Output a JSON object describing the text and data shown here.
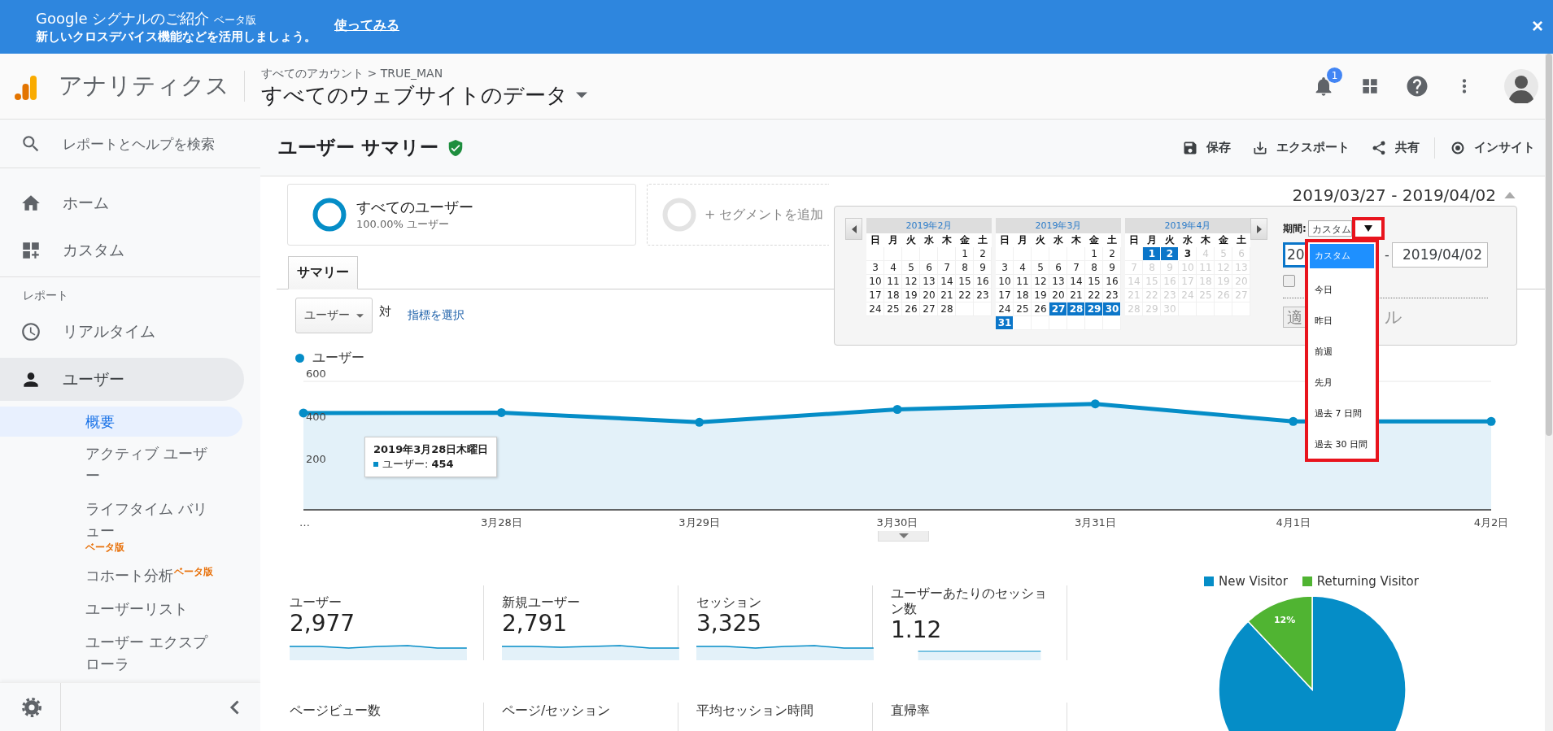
{
  "banner": {
    "title": "Google シグナルのご紹介",
    "badge": "ベータ版",
    "message": "新しいクロスデバイス機能などを活用しましょう。",
    "link": "使ってみる",
    "close": "×"
  },
  "header": {
    "product": "アナリティクス",
    "breadcrumb": "すべてのアカウント > TRUE_MAN",
    "view": "すべてのウェブサイトのデータ",
    "notifications": "1"
  },
  "sidebar": {
    "search": {
      "placeholder": "レポートとヘルプを検索"
    },
    "items": [
      {
        "kind": "home",
        "label": "ホーム",
        "selected": false
      },
      {
        "kind": "dashboards",
        "label": "カスタム",
        "selected": false
      },
      {
        "kind": "section",
        "label": "レポート"
      },
      {
        "kind": "clock",
        "label": "リアルタイム",
        "selected": false
      },
      {
        "kind": "person",
        "label": "ユーザー",
        "selected": true,
        "children": [
          {
            "kind": "plain",
            "label": "概要",
            "selected": true
          },
          {
            "kind": "plain",
            "label": "アクティブ ユーザー",
            "selected": false
          },
          {
            "kind": "badge_below",
            "label": "ライフタイム バリュー",
            "selected": false,
            "badge": "ベータ版"
          },
          {
            "kind": "badge_super",
            "label": "コホート分析",
            "selected": false,
            "badge": "ベータ版"
          },
          {
            "kind": "plain",
            "label": "ユーザーリスト",
            "selected": false
          },
          {
            "kind": "plain",
            "label": "ユーザー エクスプローラ",
            "selected": false
          }
        ]
      }
    ]
  },
  "page": {
    "title": "ユーザー サマリー",
    "actions": [
      {
        "kind": "save",
        "label": "保存"
      },
      {
        "kind": "export",
        "label": "エクスポート"
      },
      {
        "kind": "share",
        "label": "共有"
      },
      {
        "kind": "insights",
        "label": "インサイト"
      }
    ]
  },
  "segments": [
    {
      "kind": "segment",
      "name": "すべてのユーザー",
      "detail": "100.00% ユーザー"
    },
    {
      "kind": "add",
      "name": "+ セグメントを追加"
    }
  ],
  "date_range": {
    "label": "2019/03/27 - 2019/04/02",
    "expanded": true
  },
  "calendar": {
    "months": [
      {
        "title": "2019年2月",
        "weekdays": [
          "日",
          "月",
          "火",
          "水",
          "木",
          "金",
          "土"
        ],
        "days": [
          {
            "kind": "blank"
          },
          {
            "kind": "blank"
          },
          {
            "kind": "blank"
          },
          {
            "kind": "blank"
          },
          {
            "kind": "blank"
          },
          {
            "kind": "day",
            "d": "1",
            "selected": false,
            "today": false,
            "disabled": false
          },
          {
            "kind": "day",
            "d": "2",
            "selected": false,
            "today": false,
            "disabled": false
          },
          {
            "kind": "day",
            "d": "3",
            "selected": false,
            "today": false,
            "disabled": false
          },
          {
            "kind": "day",
            "d": "4",
            "selected": false,
            "today": false,
            "disabled": false
          },
          {
            "kind": "day",
            "d": "5",
            "selected": false,
            "today": false,
            "disabled": false
          },
          {
            "kind": "day",
            "d": "6",
            "selected": false,
            "today": false,
            "disabled": false
          },
          {
            "kind": "day",
            "d": "7",
            "selected": false,
            "today": false,
            "disabled": false
          },
          {
            "kind": "day",
            "d": "8",
            "selected": false,
            "today": false,
            "disabled": false
          },
          {
            "kind": "day",
            "d": "9",
            "selected": false,
            "today": false,
            "disabled": false
          },
          {
            "kind": "day",
            "d": "10",
            "selected": false,
            "today": false,
            "disabled": false
          },
          {
            "kind": "day",
            "d": "11",
            "selected": false,
            "today": false,
            "disabled": false
          },
          {
            "kind": "day",
            "d": "12",
            "selected": false,
            "today": false,
            "disabled": false
          },
          {
            "kind": "day",
            "d": "13",
            "selected": false,
            "today": false,
            "disabled": false
          },
          {
            "kind": "day",
            "d": "14",
            "selected": false,
            "today": false,
            "disabled": false
          },
          {
            "kind": "day",
            "d": "15",
            "selected": false,
            "today": false,
            "disabled": false
          },
          {
            "kind": "day",
            "d": "16",
            "selected": false,
            "today": false,
            "disabled": false
          },
          {
            "kind": "day",
            "d": "17",
            "selected": false,
            "today": false,
            "disabled": false
          },
          {
            "kind": "day",
            "d": "18",
            "selected": false,
            "today": false,
            "disabled": false
          },
          {
            "kind": "day",
            "d": "19",
            "selected": false,
            "today": false,
            "disabled": false
          },
          {
            "kind": "day",
            "d": "20",
            "selected": false,
            "today": false,
            "disabled": false
          },
          {
            "kind": "day",
            "d": "21",
            "selected": false,
            "today": false,
            "disabled": false
          },
          {
            "kind": "day",
            "d": "22",
            "selected": false,
            "today": false,
            "disabled": false
          },
          {
            "kind": "day",
            "d": "23",
            "selected": false,
            "today": false,
            "disabled": false
          },
          {
            "kind": "day",
            "d": "24",
            "selected": false,
            "today": false,
            "disabled": false
          },
          {
            "kind": "day",
            "d": "25",
            "selected": false,
            "today": false,
            "disabled": false
          },
          {
            "kind": "day",
            "d": "26",
            "selected": false,
            "today": false,
            "disabled": false
          },
          {
            "kind": "day",
            "d": "27",
            "selected": false,
            "today": false,
            "disabled": false
          },
          {
            "kind": "day",
            "d": "28",
            "selected": false,
            "today": false,
            "disabled": false
          }
        ]
      },
      {
        "title": "2019年3月",
        "weekdays": [
          "日",
          "月",
          "火",
          "水",
          "木",
          "金",
          "土"
        ],
        "days": [
          {
            "kind": "blank"
          },
          {
            "kind": "blank"
          },
          {
            "kind": "blank"
          },
          {
            "kind": "blank"
          },
          {
            "kind": "blank"
          },
          {
            "kind": "day",
            "d": "1",
            "selected": false,
            "today": false,
            "disabled": false
          },
          {
            "kind": "day",
            "d": "2",
            "selected": false,
            "today": false,
            "disabled": false
          },
          {
            "kind": "day",
            "d": "3",
            "selected": false,
            "today": false,
            "disabled": false
          },
          {
            "kind": "day",
            "d": "4",
            "selected": false,
            "today": false,
            "disabled": false
          },
          {
            "kind": "day",
            "d": "5",
            "selected": false,
            "today": false,
            "disabled": false
          },
          {
            "kind": "day",
            "d": "6",
            "selected": false,
            "today": false,
            "disabled": false
          },
          {
            "kind": "day",
            "d": "7",
            "selected": false,
            "today": false,
            "disabled": false
          },
          {
            "kind": "day",
            "d": "8",
            "selected": false,
            "today": false,
            "disabled": false
          },
          {
            "kind": "day",
            "d": "9",
            "selected": false,
            "today": false,
            "disabled": false
          },
          {
            "kind": "day",
            "d": "10",
            "selected": false,
            "today": false,
            "disabled": false
          },
          {
            "kind": "day",
            "d": "11",
            "selected": false,
            "today": false,
            "disabled": false
          },
          {
            "kind": "day",
            "d": "12",
            "selected": false,
            "today": false,
            "disabled": false
          },
          {
            "kind": "day",
            "d": "13",
            "selected": false,
            "today": false,
            "disabled": false
          },
          {
            "kind": "day",
            "d": "14",
            "selected": false,
            "today": false,
            "disabled": false
          },
          {
            "kind": "day",
            "d": "15",
            "selected": false,
            "today": false,
            "disabled": false
          },
          {
            "kind": "day",
            "d": "16",
            "selected": false,
            "today": false,
            "disabled": false
          },
          {
            "kind": "day",
            "d": "17",
            "selected": false,
            "today": false,
            "disabled": false
          },
          {
            "kind": "day",
            "d": "18",
            "selected": false,
            "today": false,
            "disabled": false
          },
          {
            "kind": "day",
            "d": "19",
            "selected": false,
            "today": false,
            "disabled": false
          },
          {
            "kind": "day",
            "d": "20",
            "selected": false,
            "today": false,
            "disabled": false
          },
          {
            "kind": "day",
            "d": "21",
            "selected": false,
            "today": false,
            "disabled": false
          },
          {
            "kind": "day",
            "d": "22",
            "selected": false,
            "today": false,
            "disabled": false
          },
          {
            "kind": "day",
            "d": "23",
            "selected": false,
            "today": false,
            "disabled": false
          },
          {
            "kind": "day",
            "d": "24",
            "selected": false,
            "today": false,
            "disabled": false
          },
          {
            "kind": "day",
            "d": "25",
            "selected": false,
            "today": false,
            "disabled": false
          },
          {
            "kind": "day",
            "d": "26",
            "selected": false,
            "today": false,
            "disabled": false
          },
          {
            "kind": "day",
            "d": "27",
            "selected": true,
            "today": false,
            "disabled": false
          },
          {
            "kind": "day",
            "d": "28",
            "selected": true,
            "today": false,
            "disabled": false
          },
          {
            "kind": "day",
            "d": "29",
            "selected": true,
            "today": false,
            "disabled": false
          },
          {
            "kind": "day",
            "d": "30",
            "selected": true,
            "today": false,
            "disabled": false
          },
          {
            "kind": "day",
            "d": "31",
            "selected": true,
            "today": false,
            "disabled": false
          }
        ]
      },
      {
        "title": "2019年4月",
        "weekdays": [
          "日",
          "月",
          "火",
          "水",
          "木",
          "金",
          "土"
        ],
        "days": [
          {
            "kind": "blank"
          },
          {
            "kind": "day",
            "d": "1",
            "selected": true,
            "today": false,
            "disabled": false
          },
          {
            "kind": "day",
            "d": "2",
            "selected": true,
            "today": false,
            "disabled": false
          },
          {
            "kind": "day",
            "d": "3",
            "selected": false,
            "today": true,
            "disabled": false
          },
          {
            "kind": "day",
            "d": "4",
            "selected": false,
            "today": false,
            "disabled": true
          },
          {
            "kind": "day",
            "d": "5",
            "selected": false,
            "today": false,
            "disabled": true
          },
          {
            "kind": "day",
            "d": "6",
            "selected": false,
            "today": false,
            "disabled": true
          },
          {
            "kind": "day",
            "d": "7",
            "selected": false,
            "today": false,
            "disabled": true
          },
          {
            "kind": "day",
            "d": "8",
            "selected": false,
            "today": false,
            "disabled": true
          },
          {
            "kind": "day",
            "d": "9",
            "selected": false,
            "today": false,
            "disabled": true
          },
          {
            "kind": "day",
            "d": "10",
            "selected": false,
            "today": false,
            "disabled": true
          },
          {
            "kind": "day",
            "d": "11",
            "selected": false,
            "today": false,
            "disabled": true
          },
          {
            "kind": "day",
            "d": "12",
            "selected": false,
            "today": false,
            "disabled": true
          },
          {
            "kind": "day",
            "d": "13",
            "selected": false,
            "today": false,
            "disabled": true
          },
          {
            "kind": "day",
            "d": "14",
            "selected": false,
            "today": false,
            "disabled": true
          },
          {
            "kind": "day",
            "d": "15",
            "selected": false,
            "today": false,
            "disabled": true
          },
          {
            "kind": "day",
            "d": "16",
            "selected": false,
            "today": false,
            "disabled": true
          },
          {
            "kind": "day",
            "d": "17",
            "selected": false,
            "today": false,
            "disabled": true
          },
          {
            "kind": "day",
            "d": "18",
            "selected": false,
            "today": false,
            "disabled": true
          },
          {
            "kind": "day",
            "d": "19",
            "selected": false,
            "today": false,
            "disabled": true
          },
          {
            "kind": "day",
            "d": "20",
            "selected": false,
            "today": false,
            "disabled": true
          },
          {
            "kind": "day",
            "d": "21",
            "selected": false,
            "today": false,
            "disabled": true
          },
          {
            "kind": "day",
            "d": "22",
            "selected": false,
            "today": false,
            "disabled": true
          },
          {
            "kind": "day",
            "d": "23",
            "selected": false,
            "today": false,
            "disabled": true
          },
          {
            "kind": "day",
            "d": "24",
            "selected": false,
            "today": false,
            "disabled": true
          },
          {
            "kind": "day",
            "d": "25",
            "selected": false,
            "today": false,
            "disabled": true
          },
          {
            "kind": "day",
            "d": "26",
            "selected": false,
            "today": false,
            "disabled": true
          },
          {
            "kind": "day",
            "d": "27",
            "selected": false,
            "today": false,
            "disabled": true
          },
          {
            "kind": "day",
            "d": "28",
            "selected": false,
            "today": false,
            "disabled": true
          },
          {
            "kind": "day",
            "d": "29",
            "selected": false,
            "today": false,
            "disabled": true
          },
          {
            "kind": "day",
            "d": "30",
            "selected": false,
            "today": false,
            "disabled": true
          }
        ]
      }
    ],
    "period_label": "期間:",
    "period": "カスタム",
    "highlighted": true,
    "options": [
      {
        "label": "カスタム",
        "selected": true
      },
      {
        "label": "今日",
        "selected": false
      },
      {
        "label": "昨日",
        "selected": false
      },
      {
        "label": "前週",
        "selected": false
      },
      {
        "label": "先月",
        "selected": false
      },
      {
        "label": "過去 7 日間",
        "selected": false
      },
      {
        "label": "過去 30 日間",
        "selected": false
      }
    ],
    "start_date": "20",
    "separator": "-",
    "end_date": "2019/04/02",
    "compare_checked": false,
    "apply": "適",
    "cancel": "ル"
  },
  "tabs": [
    {
      "label": "サマリー",
      "selected": true
    }
  ],
  "metric_picker": {
    "value": "ユーザー",
    "versus": "対",
    "link": "指標を選択"
  },
  "chart": {
    "tooltip": {
      "title": "2019年3月28日木曜日",
      "label": "ユーザー:",
      "value": "454"
    },
    "chart_data": {
      "type": "area",
      "categories": [
        "…",
        "3月28日",
        "3月29日",
        "3月30日",
        "3月31日",
        "4月1日",
        "4月2日"
      ],
      "series": [
        {
          "name": "ユーザー",
          "color": "#058dc7",
          "values": [
            452,
            454,
            409,
            469,
            495,
            413,
            413
          ]
        }
      ],
      "ylim": [
        0,
        600
      ],
      "yticks": [
        200,
        400,
        600
      ]
    }
  },
  "metrics": [
    {
      "label": "ユーザー",
      "value": "2,977"
    },
    {
      "label": "新規ユーザー",
      "value": "2,791"
    },
    {
      "label": "セッション",
      "value": "3,325"
    },
    {
      "label": "ユーザーあたりのセッション数",
      "value": "1.12"
    },
    {
      "label": "ページビュー数"
    },
    {
      "label": "ページ/セッション"
    },
    {
      "label": "平均セッション時間"
    },
    {
      "label": "直帰率"
    }
  ],
  "visitors": {
    "chart_data": {
      "type": "pie",
      "categories": [
        "New Visitor",
        "Returning Visitor"
      ],
      "values": [
        88,
        12
      ],
      "colors": [
        "#058dc7",
        "#50b432"
      ],
      "value_labels": [
        null,
        "12%"
      ]
    }
  }
}
